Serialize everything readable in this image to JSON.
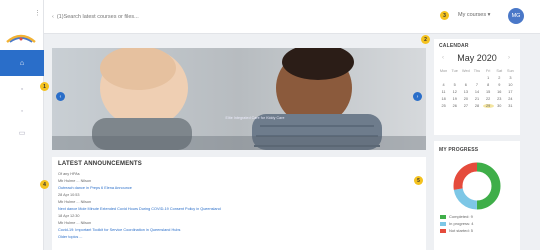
{
  "sidebar": {
    "menu_glyph": "⋮",
    "items": [
      {
        "icon": "home-icon",
        "glyph": "⌂"
      },
      {
        "icon": "calendar-icon",
        "glyph": "▫"
      },
      {
        "icon": "chart-icon",
        "glyph": "◦"
      },
      {
        "icon": "document-icon",
        "glyph": "▭"
      }
    ]
  },
  "topbar": {
    "search_placeholder": "(1)Search latest courses or files...",
    "search_glyph": "‹",
    "language_label": "My courses ▾",
    "avatar_initials": "MG"
  },
  "markers": [
    "1",
    "2",
    "3",
    "4",
    "5"
  ],
  "hero": {
    "caption": "Elite Integrated Care for Kiddy Care",
    "prev_glyph": "‹",
    "next_glyph": "›"
  },
  "announcements": {
    "title": "LATEST ANNOUNCEMENTS",
    "lines": [
      "Of any HPAs",
      "Mb Hulme ... Nilson",
      "Outreach dance in Preps 6 Elena Announce",
      "28 Apr 10:53",
      "Mb Hulme ... Nilson",
      "Next dance Mole Minute Extended Covid Hours During COVID-19 Consent Policy in Queensland",
      "18 Apr 12:30",
      "Mb Hulme ... Nilson",
      "Covid-19: Important Toolkit for Service Coordination in Queensland Hubs",
      "Older topics ..."
    ]
  },
  "calendar": {
    "title": "CALENDAR",
    "month": "May 2020",
    "prev_glyph": "‹",
    "next_glyph": "›",
    "day_names": [
      "Mon",
      "Tue",
      "Wed",
      "Thu",
      "Fri",
      "Sat",
      "Sun"
    ],
    "days": [
      "",
      "",
      "",
      "",
      "1",
      "2",
      "3",
      "4",
      "5",
      "6",
      "7",
      "8",
      "9",
      "10",
      "11",
      "12",
      "13",
      "14",
      "15",
      "16",
      "17",
      "18",
      "19",
      "20",
      "21",
      "22",
      "23",
      "24",
      "25",
      "26",
      "27",
      "28",
      "29",
      "30",
      "31"
    ],
    "today": "29"
  },
  "progress": {
    "title": "MY PROGRESS",
    "segments": [
      {
        "label": "Completed: 9",
        "value": 9,
        "color": "#3fae49"
      },
      {
        "label": "In progress: 4",
        "value": 4,
        "color": "#7dc7e6"
      },
      {
        "label": "Not started: 5",
        "value": 5,
        "color": "#e54b3c"
      }
    ]
  },
  "colors": {
    "accent": "#2a6ec9",
    "marker": "#f4c21f"
  }
}
